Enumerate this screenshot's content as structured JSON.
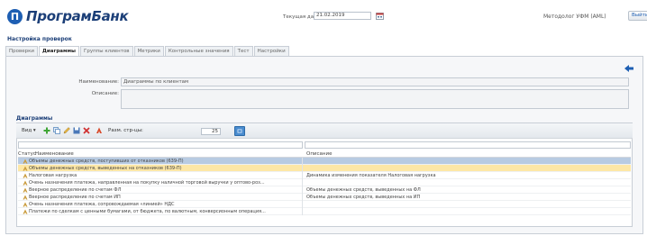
{
  "app": {
    "logo_letter": "П",
    "logo_text": "ПрограмБанк"
  },
  "header": {
    "date_label": "Текущая дата",
    "date_value": "21.02.2019",
    "user": "Методолог УФМ (AML)",
    "exit_label": "Выйти"
  },
  "page_title": "Настройка проверок",
  "tabs": [
    {
      "label": "Проверки",
      "active": false
    },
    {
      "label": "Диаграммы",
      "active": true
    },
    {
      "label": "Группы клиентов",
      "active": false
    },
    {
      "label": "Метрики",
      "active": false
    },
    {
      "label": "Контрольные значения",
      "active": false
    },
    {
      "label": "Тест",
      "active": false
    },
    {
      "label": "Настройки",
      "active": false
    }
  ],
  "form": {
    "name_label": "Наименование:",
    "name_value": "Диаграммы по клиентам",
    "desc_label": "Описание:",
    "desc_value": ""
  },
  "grid": {
    "title": "Диаграммы",
    "view_label": "Вид ▾",
    "page_size_label": "Разм. стр-цы:",
    "page_size_value": "25",
    "col_status": "Статус",
    "col_name": "Наименование",
    "col_desc": "Описание",
    "rows": [
      {
        "name": "Объемы денежных средств, поступивших от отказников (639-П)",
        "desc": ""
      },
      {
        "name": "Объемы денежных средств, выведенных на отказников (639-П)",
        "desc": ""
      },
      {
        "name": "Налоговая нагрузка",
        "desc": "Динамика изменения показателя Налоговая нагрузка"
      },
      {
        "name": "Очень назначения платежа, направленная на покупку наличной торговой выручки у оптово-роз...",
        "desc": ""
      },
      {
        "name": "Веерное распределение по счетам ФЛ",
        "desc": "Объемы денежных средств, выведенных на ФЛ"
      },
      {
        "name": "Веерное распределение по счетам ИП",
        "desc": "Объемы денежных средств, выведенных на ИП"
      },
      {
        "name": "Очень назначения платежа, сопровождаемая «линией» НДС",
        "desc": ""
      },
      {
        "name": "Платежи по сделкам с ценными бумагами, от бюджета, по валютным, конверсионным операция...",
        "desc": ""
      }
    ]
  },
  "colors": {
    "accent": "#1e5fb3",
    "selected_row": "#b8cbe2",
    "highlight_row": "#fde7a6"
  }
}
